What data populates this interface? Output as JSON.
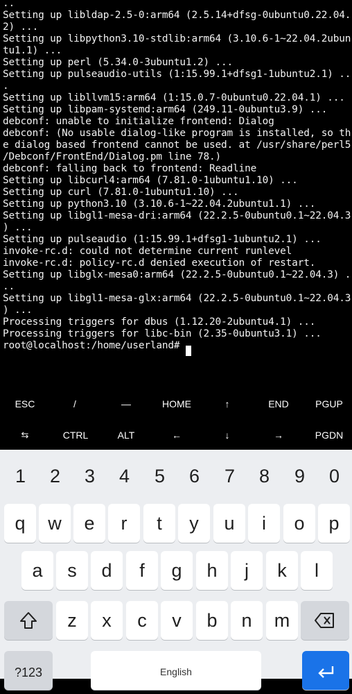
{
  "terminal": {
    "lines": [
      "..",
      "Setting up libldap-2.5-0:arm64 (2.5.14+dfsg-0ubuntu0.22.04.",
      "2) ...",
      "Setting up libpython3.10-stdlib:arm64 (3.10.6-1~22.04.2ubun",
      "tu1.1) ...",
      "Setting up perl (5.34.0-3ubuntu1.2) ...",
      "Setting up pulseaudio-utils (1:15.99.1+dfsg1-1ubuntu2.1) ..",
      ".",
      "Setting up libllvm15:arm64 (1:15.0.7-0ubuntu0.22.04.1) ...",
      "Setting up libpam-systemd:arm64 (249.11-0ubuntu3.9) ...",
      "debconf: unable to initialize frontend: Dialog",
      "debconf: (No usable dialog-like program is installed, so th",
      "e dialog based frontend cannot be used. at /usr/share/perl5",
      "/Debconf/FrontEnd/Dialog.pm line 78.)",
      "debconf: falling back to frontend: Readline",
      "Setting up libcurl4:arm64 (7.81.0-1ubuntu1.10) ...",
      "Setting up curl (7.81.0-1ubuntu1.10) ...",
      "Setting up python3.10 (3.10.6-1~22.04.2ubuntu1.1) ...",
      "Setting up libgl1-mesa-dri:arm64 (22.2.5-0ubuntu0.1~22.04.3",
      ") ...",
      "Setting up pulseaudio (1:15.99.1+dfsg1-1ubuntu2.1) ...",
      "invoke-rc.d: could not determine current runlevel",
      "invoke-rc.d: policy-rc.d denied execution of restart.",
      "Setting up libglx-mesa0:arm64 (22.2.5-0ubuntu0.1~22.04.3) .",
      "..",
      "Setting up libgl1-mesa-glx:arm64 (22.2.5-0ubuntu0.1~22.04.3",
      ") ...",
      "Processing triggers for dbus (1.12.20-2ubuntu4.1) ...",
      "Processing triggers for libc-bin (2.35-0ubuntu3.1) ...",
      "root@localhost:/home/userland# "
    ]
  },
  "extra_keys": {
    "row1": [
      "ESC",
      "/",
      "—",
      "HOME",
      "↑",
      "END",
      "PGUP"
    ],
    "row2": [
      "⇆",
      "CTRL",
      "ALT",
      "←",
      "↓",
      "→",
      "PGDN"
    ]
  },
  "keyboard": {
    "numbers": [
      "1",
      "2",
      "3",
      "4",
      "5",
      "6",
      "7",
      "8",
      "9",
      "0"
    ],
    "row1": [
      "q",
      "w",
      "e",
      "r",
      "t",
      "y",
      "u",
      "i",
      "o",
      "p"
    ],
    "row2": [
      "a",
      "s",
      "d",
      "f",
      "g",
      "h",
      "j",
      "k",
      "l"
    ],
    "row3": [
      "z",
      "x",
      "c",
      "v",
      "b",
      "n",
      "m"
    ],
    "symbols_label": "?123",
    "space_label": "English",
    "shift_icon": "shift-icon",
    "backspace_icon": "backspace-icon",
    "enter_icon": "enter-icon"
  }
}
